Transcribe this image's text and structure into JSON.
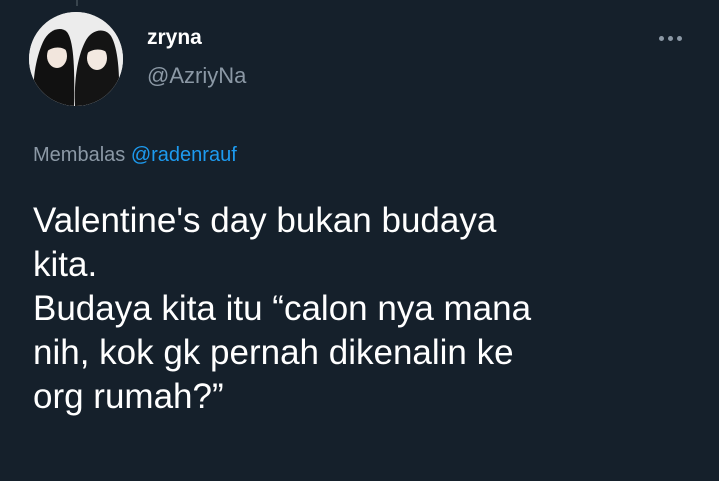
{
  "author": {
    "display_name": "zryna",
    "username": "@AzriyNa",
    "avatar_icon": "profile-photo-two-people"
  },
  "reply": {
    "prefix": "Membalas",
    "mention": "@radenrauf"
  },
  "tweet": {
    "lines": [
      "Valentine's day bukan budaya",
      "kita.",
      "Budaya kita itu “calon nya mana",
      "nih, kok gk pernah dikenalin ke",
      "org rumah?”"
    ]
  },
  "menu": {
    "icon": "more-horizontal-icon"
  },
  "colors": {
    "background": "#15202b",
    "primary_text": "#ffffff",
    "secondary_text": "#8b98a5",
    "accent": "#1d9bf0"
  }
}
